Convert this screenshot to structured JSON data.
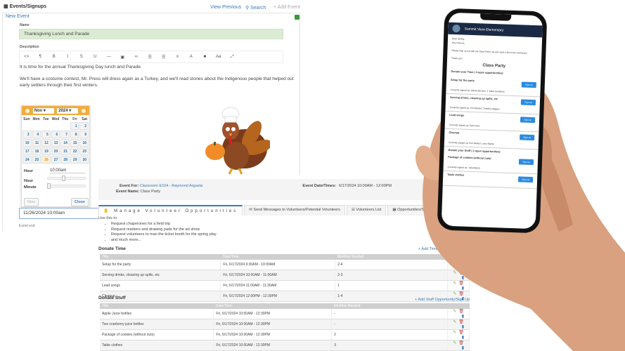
{
  "header": {
    "title": "Events/Signups",
    "view_previous": "View Previous",
    "search": "Search",
    "add_event": "+ Add Event"
  },
  "form": {
    "panel_title": "New Event",
    "name_label": "Name",
    "name_value": "Thanksgiving Lunch and Parade",
    "description_label": "Description",
    "toolbar": [
      "<>",
      "¶",
      "B",
      "I",
      "S",
      "U",
      "—",
      "▣",
      "∞",
      "☰",
      "☰",
      "≡",
      "A",
      "■",
      "Aa",
      "⤢"
    ],
    "description_lines": [
      "It is time for the annual Thanksgiving Day lunch and Parade.",
      "We'll have a costume contest, Mr. Press will dress again as a Turkey, and we'll read stories about the Indigenous people that helped out",
      "early settlers through their first winters."
    ],
    "start_value": "11/26/2024 10:00am",
    "event_end_label": "Event end"
  },
  "calendar": {
    "month": "Nov",
    "year": "2024",
    "days_of_week": [
      "Sun",
      "Mon",
      "Tue",
      "Wed",
      "Thu",
      "Fri",
      "Sat"
    ],
    "weeks": [
      [
        "",
        "",
        "",
        "",
        "",
        "1",
        "2"
      ],
      [
        "3",
        "4",
        "5",
        "6",
        "7",
        "8",
        "9"
      ],
      [
        "10",
        "11",
        "12",
        "13",
        "14",
        "15",
        "16"
      ],
      [
        "17",
        "18",
        "19",
        "20",
        "21",
        "22",
        "23"
      ],
      [
        "24",
        "25",
        "26",
        "27",
        "28",
        "29",
        "30"
      ]
    ],
    "selected_day": "26",
    "hour_label": "Hour",
    "time_value": "10:00am",
    "hour_slider_label": "Hour",
    "minute_slider_label": "Minute",
    "hour_fraction": 0.42,
    "minute_fraction": 0.0,
    "now_button": "Now",
    "close_button": "Close"
  },
  "event": {
    "for_label": "Event For:",
    "for_value": "Classroom E104 - Raymond Argueta",
    "name_label": "Event Name:",
    "name_value": "Class Party",
    "datetime_label": "Event Date/Times:",
    "datetime_value": "6/17/2024 10:00AM - 12:00PM"
  },
  "tabs": [
    "Manage Volunteer Opportunities",
    "Send Messages to Volunteers/Potential Volunteers",
    "Volunteers List",
    "Opportunities/Sign Ups Table"
  ],
  "use_this": "Use this to:",
  "bullets": [
    "Request chaperones for a field trip",
    "Request markers and drawing pads for the art show",
    "Request volunteers to man the ticket booth for the spring play",
    "and much more..."
  ],
  "donate_time": {
    "title": "Donate Time",
    "add_link": "+ Add Time Op",
    "columns": [
      "Title",
      "Date/Time",
      "Min/Max Needed",
      ""
    ],
    "rows": [
      [
        "Setup for the party",
        "Fri, 6/17/2024 9:30AM - 10:00AM",
        "2-4"
      ],
      [
        "Serving drinks, cleaning up spills, etc",
        "Fri, 6/17/2024 10:00AM - 11:00AM",
        "2-3"
      ],
      [
        "Lead songs",
        "Fri, 6/17/2024 11:00AM - 11:30AM",
        "1"
      ],
      [
        "Cleanup",
        "Fri, 6/17/2024 12:00PM - 12:30PM",
        "1-4"
      ]
    ]
  },
  "donate_stuff": {
    "title": "Donate Stuff",
    "add_link": "+ Add Stuff Opportunity/Sign Up",
    "columns": [
      "Title",
      "Date/Time",
      "Min/Max Needed",
      ""
    ],
    "rows": [
      [
        "Apple Juice bottles",
        "Fri, 6/17/2024 10:00AM - 12:30PM",
        "-"
      ],
      [
        "Two cranberry juice bottles",
        "Fri, 6/17/2024 10:00AM - 12:30PM",
        "-"
      ],
      [
        "Package of cookies (without nuts)",
        "Fri, 6/17/2024 10:00AM - 12:30PM",
        "2"
      ],
      [
        "Table clothes",
        "Fri, 6/17/2024 10:00AM - 12:30PM",
        "3"
      ]
    ]
  },
  "phone": {
    "school": "Summit View Elementary",
    "greeting": "Dear Spring,",
    "greeting2": "Hey Parents,",
    "body": "Please help us out with the Class Party, we just need a few more volunteers.",
    "thanks": "Thank you!",
    "event_title": "Class Party",
    "time_section": "Donate your Time ( 4 open opportunities)",
    "items": [
      {
        "title": "Setup for the party",
        "note": "Currently signed up: Ashley Benson, T. Mike Goodman"
      },
      {
        "title": "Serving drinks, cleaning up spills, etc",
        "note": "Currently signed up: Kim Bartlett, Timothy Hoggan"
      },
      {
        "title": "Lead songs",
        "note": "Currently signed up: Sam Ford"
      },
      {
        "title": "Cleanup",
        "note": "Currently signed up: Kim Bartlett, Larry Beetle"
      }
    ],
    "stuff_section": "Donate your Stuff ( 2 open opportunities)",
    "stuff_items": [
      {
        "title": "Package of cookies (without nuts)",
        "note": "Currently signed up: Julia Barrett"
      },
      {
        "title": "Table clothes",
        "note": ""
      }
    ],
    "signup_button": "Sign up"
  }
}
